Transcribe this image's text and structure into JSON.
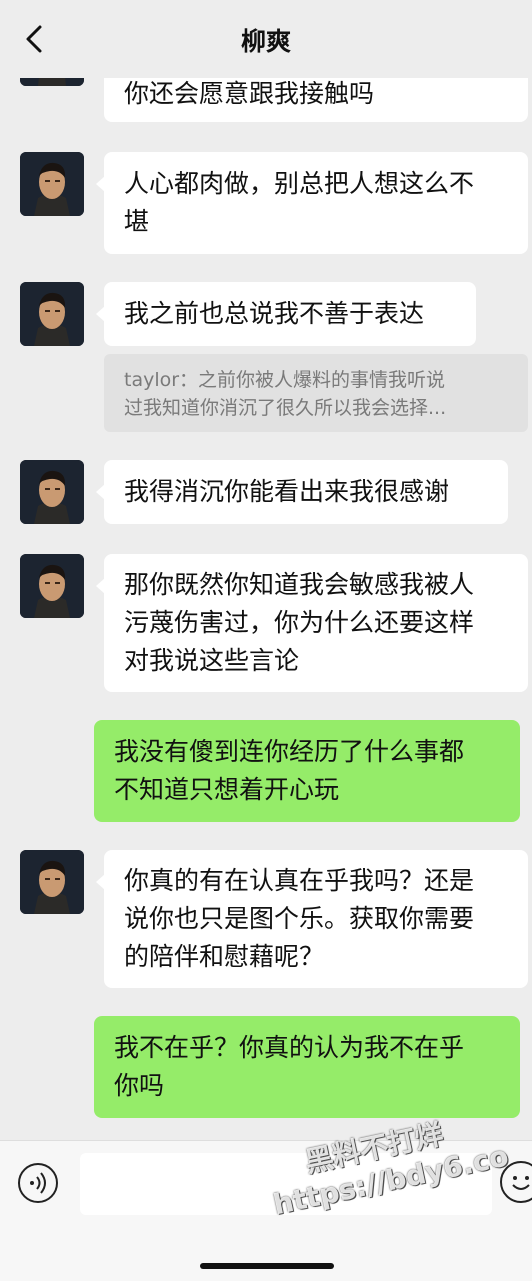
{
  "header": {
    "back_icon": "chevron-left-icon",
    "title": "柳爽"
  },
  "messages": [
    {
      "side": "left",
      "lines": [
        "你还会愿意跟我接触吗"
      ]
    },
    {
      "side": "left",
      "lines": [
        "人心都肉做，别总把人想这么不",
        "堪"
      ]
    },
    {
      "side": "left",
      "lines": [
        "我之前也总说我不善于表达"
      ]
    },
    {
      "side": "left",
      "lines": [
        "我得消沉你能看出来我很感谢"
      ]
    },
    {
      "side": "left",
      "lines": [
        "那你既然你知道我会敏感我被人",
        "污蔑伤害过，你为什么还要这样",
        "对我说这些言论"
      ]
    },
    {
      "side": "right",
      "lines": [
        "我没有傻到连你经历了什么事都",
        "不知道只想着开心玩"
      ]
    },
    {
      "side": "left",
      "lines": [
        "你真的有在认真在乎我吗？还是",
        "说你也只是图个乐。获取你需要",
        "的陪伴和慰藉呢？"
      ]
    },
    {
      "side": "right",
      "lines": [
        "我不在乎？你真的认为我不在乎",
        "你吗"
      ]
    }
  ],
  "quote": {
    "lines": [
      "taylor：之前你被人爆料的事情我听说",
      "过我知道你消沉了很久所以我会选择..."
    ]
  },
  "input_bar": {
    "voice_icon": "voice-icon",
    "emoji_icon": "emoji-icon",
    "input_value": ""
  },
  "watermark": {
    "line1": "黑料不打烊",
    "line2": "https://bdy6.co"
  },
  "colors": {
    "background": "#ededed",
    "incoming_bubble": "#ffffff",
    "outgoing_bubble": "#95ec69",
    "quote_bg": "#e1e1e1"
  }
}
